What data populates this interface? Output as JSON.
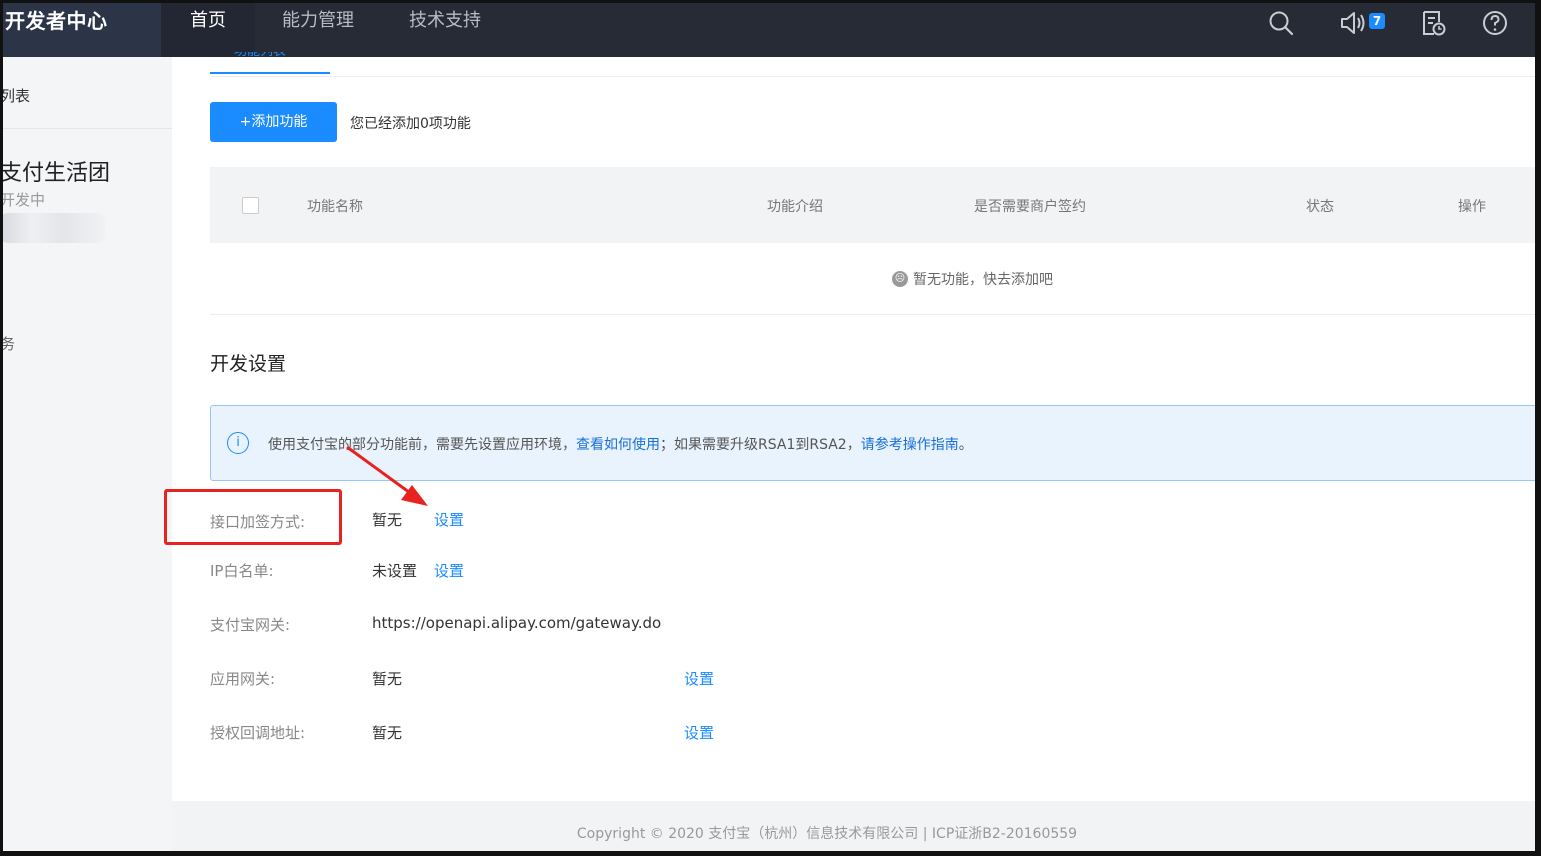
{
  "topbar": {
    "brand": "开发者中心",
    "nav": [
      "首页",
      "能力管理",
      "技术支持"
    ],
    "icons": [
      "search-icon",
      "speaker-icon",
      "list-clock-icon",
      "help-icon"
    ],
    "badge": "7"
  },
  "sidebar": {
    "list_label": "列表",
    "app_name": "支付生活团",
    "app_status": "开发中",
    "task_label": "务"
  },
  "main": {
    "tab_label": "功能列表",
    "add_button": "+添加功能",
    "add_hint": "您已经添加0项功能",
    "table": {
      "headers": [
        "功能名称",
        "功能介绍",
        "是否需要商户签约",
        "状态",
        "操作"
      ],
      "empty_text": "暂无功能，快去添加吧"
    },
    "dev_settings": {
      "title": "开发设置",
      "info": {
        "prefix": "使用支付宝的部分功能前，需要先设置应用环境，",
        "link1": "查看如何使用",
        "middle": "；如果需要升级RSA1到RSA2，",
        "link2": "请参考操作指南",
        "suffix": "。"
      },
      "rows": [
        {
          "label": "接口加签方式:",
          "value": "暂无",
          "action": "设置"
        },
        {
          "label": "IP白名单:",
          "value": "未设置",
          "action": "设置"
        },
        {
          "label": "支付宝网关:",
          "value": "https://openapi.alipay.com/gateway.do",
          "action": ""
        },
        {
          "label": "应用网关:",
          "value": "暂无",
          "action": "设置"
        },
        {
          "label": "授权回调地址:",
          "value": "暂无",
          "action": "设置"
        }
      ]
    },
    "footer": "Copyright © 2020 支付宝（杭州）信息技术有限公司 | ICP证浙B2-20160559"
  },
  "colors": {
    "topbar_bg": "#262b36",
    "accent": "#1a8cff",
    "annotation_red": "#e8221e"
  }
}
